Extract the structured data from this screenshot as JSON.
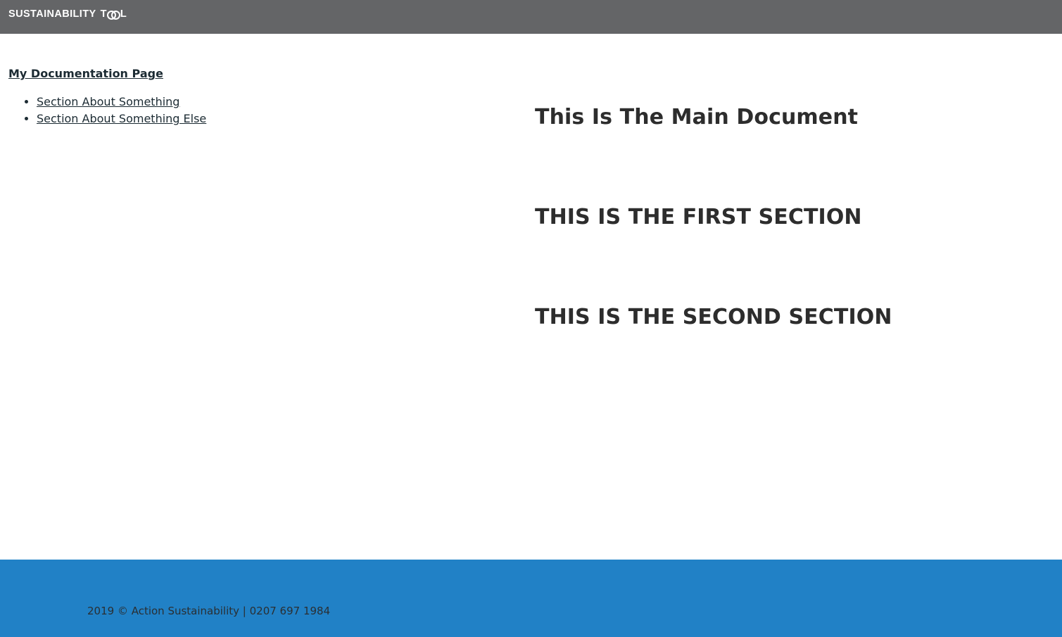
{
  "header": {
    "logo_part1": "SUSTAINABILITY",
    "logo_part2_start": "T",
    "logo_part2_end": "L",
    "background": "#646567"
  },
  "sidebar": {
    "doc_title": "My Documentation Page",
    "items": [
      {
        "label": "Section About Something"
      },
      {
        "label": "Section About Something Else"
      }
    ]
  },
  "main": {
    "title": "This Is The Main Document",
    "sections": [
      {
        "heading": "THIS IS THE FIRST SECTION"
      },
      {
        "heading": "THIS IS THE SECOND SECTION"
      }
    ]
  },
  "footer": {
    "text": "2019 © Action Sustainability | 0207 697 1984",
    "background": "#2181c6"
  }
}
